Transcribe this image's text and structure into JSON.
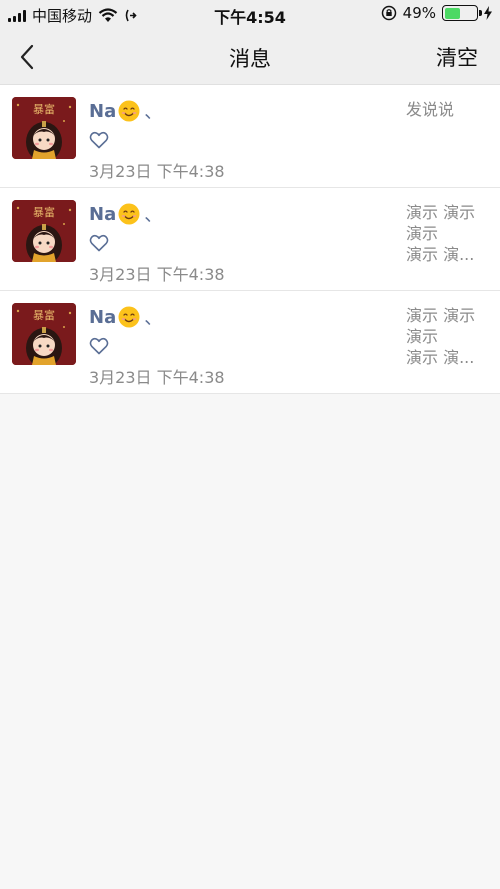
{
  "status_bar": {
    "carrier": "中国移动",
    "time": "下午4:54",
    "battery_percent": "49%",
    "battery_level": 0.49
  },
  "nav": {
    "title": "消息",
    "clear_label": "清空"
  },
  "avatar_text": "暴富",
  "messages": [
    {
      "name": "Na",
      "suffix": "、",
      "time": "3月23日 下午4:38",
      "preview": [
        "发说说"
      ]
    },
    {
      "name": "Na",
      "suffix": "、",
      "time": "3月23日 下午4:38",
      "preview": [
        "演示 演示",
        " 演示",
        "演示 演..."
      ]
    },
    {
      "name": "Na",
      "suffix": "、",
      "time": "3月23日 下午4:38",
      "preview": [
        "演示 演示",
        " 演示",
        "演示 演..."
      ]
    }
  ]
}
